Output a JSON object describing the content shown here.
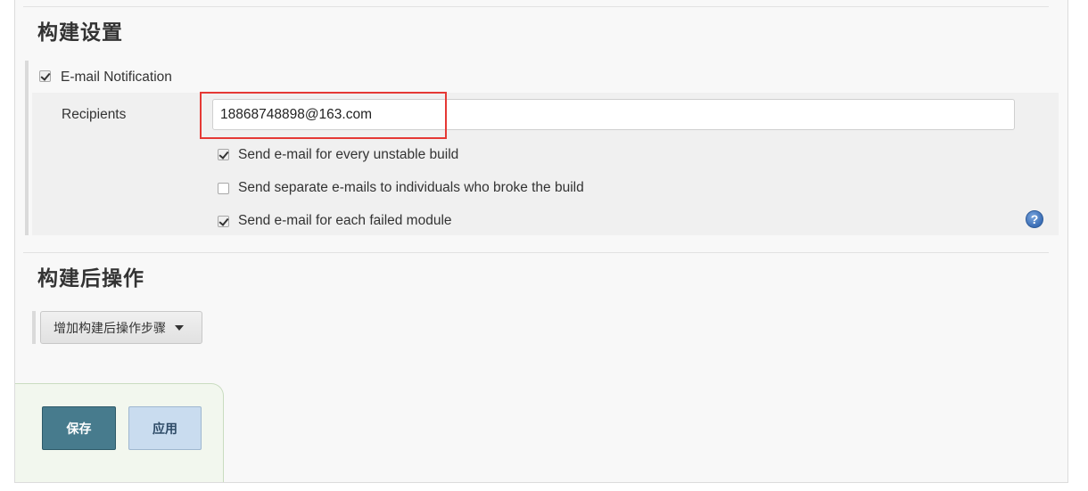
{
  "build_settings": {
    "title": "构建设置",
    "email_notification": {
      "label": "E-mail Notification",
      "checked": true,
      "recipients_label": "Recipients",
      "recipients_value": "18868748898@163.com",
      "options": [
        {
          "label": "Send e-mail for every unstable build",
          "checked": true
        },
        {
          "label": "Send separate e-mails to individuals who broke the build",
          "checked": false
        },
        {
          "label": "Send e-mail for each failed module",
          "checked": true
        }
      ],
      "help_icon": "question-mark-icon"
    }
  },
  "post_build": {
    "title": "构建后操作",
    "add_step_label": "增加构建后操作步骤"
  },
  "actions": {
    "save_label": "保存",
    "apply_label": "应用"
  },
  "colors": {
    "highlight_box": "#e53935",
    "save_button": "#477b8d",
    "apply_button": "#c9dcef"
  }
}
